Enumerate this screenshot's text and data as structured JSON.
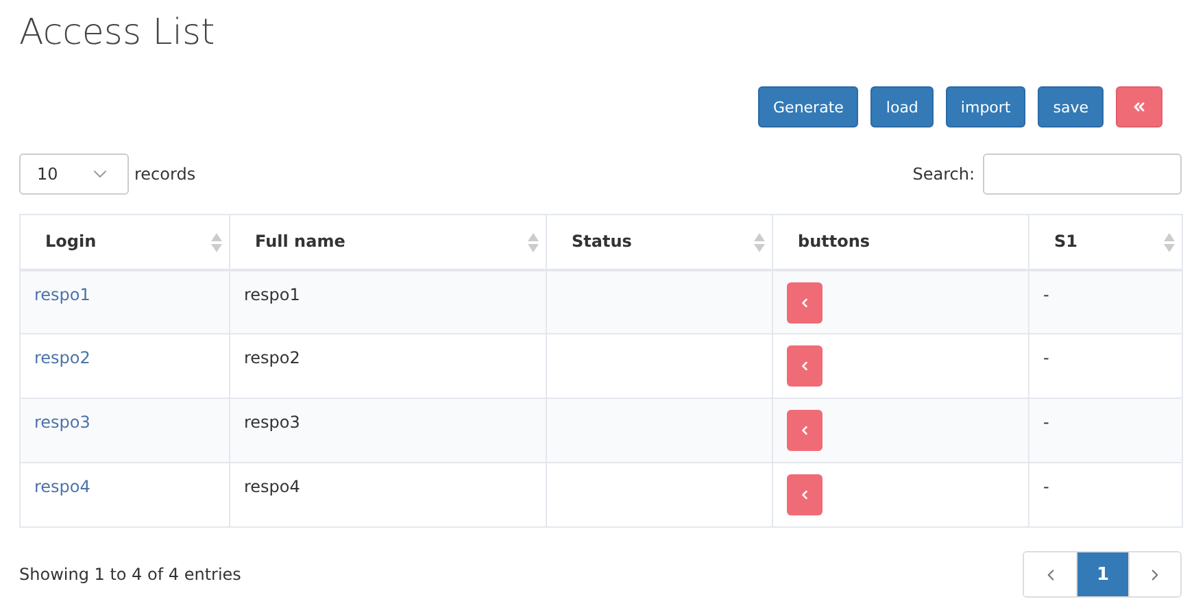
{
  "title": "Access List",
  "toolbar": [
    {
      "label": "Generate",
      "kind": "primary"
    },
    {
      "label": "load",
      "kind": "primary"
    },
    {
      "label": "import",
      "kind": "primary"
    },
    {
      "label": "save",
      "kind": "primary"
    },
    {
      "kind": "danger-icon"
    }
  ],
  "page_size": {
    "value": "10",
    "label": "records"
  },
  "search": {
    "label": "Search:"
  },
  "table": {
    "columns": [
      {
        "label": "Login",
        "sortable": true
      },
      {
        "label": "Full name",
        "sortable": true
      },
      {
        "label": "Status",
        "sortable": true
      },
      {
        "label": "buttons",
        "sortable": false
      },
      {
        "label": "S1",
        "sortable": true
      }
    ],
    "rows": [
      {
        "login": "respo1",
        "full_name": "respo1",
        "status": "",
        "s1": "-"
      },
      {
        "login": "respo2",
        "full_name": "respo2",
        "status": "",
        "s1": "-"
      },
      {
        "login": "respo3",
        "full_name": "respo3",
        "status": "",
        "s1": "-"
      },
      {
        "login": "respo4",
        "full_name": "respo4",
        "status": "",
        "s1": "-"
      }
    ]
  },
  "info": "Showing 1 to 4 of 4 entries",
  "pagination": {
    "pages": [
      {
        "label": "1",
        "selected": true
      }
    ]
  }
}
